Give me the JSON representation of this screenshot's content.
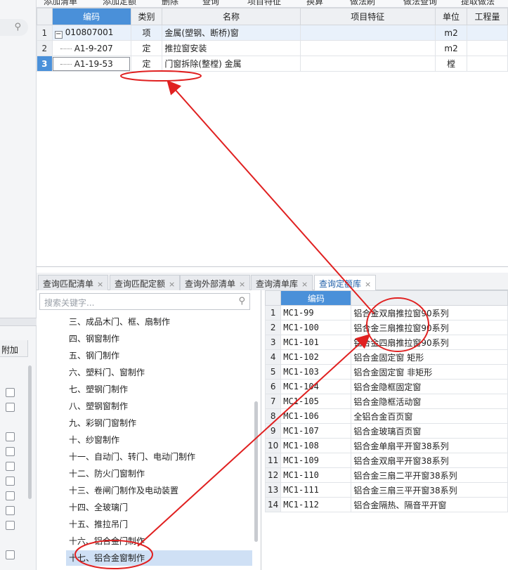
{
  "toolbar": {
    "items": [
      "添加清单",
      "添加定额",
      "删除",
      "查询",
      "项目特征",
      "换算",
      "做法刷",
      "做法查询",
      "提取做法"
    ]
  },
  "top_grid": {
    "headers": [
      "编码",
      "类别",
      "名称",
      "项目特征",
      "单位",
      "工程量"
    ],
    "rows": [
      {
        "num": "1",
        "code": "010807001",
        "type": "项",
        "name": "金属(塑钢、断桥)窗",
        "unit": "m2"
      },
      {
        "num": "2",
        "code": "A1-9-207",
        "type": "定",
        "name": "推拉窗安装",
        "unit": "m2"
      },
      {
        "num": "3",
        "code": "A1-19-53",
        "type": "定",
        "name": "门窗拆除(整樘) 金属",
        "unit": "樘"
      }
    ]
  },
  "tabs": [
    {
      "label": "查询匹配清单"
    },
    {
      "label": "查询匹配定额"
    },
    {
      "label": "查询外部清单"
    },
    {
      "label": "查询清单库"
    },
    {
      "label": "查询定额库"
    }
  ],
  "tree": {
    "search_placeholder": "搜索关键字...",
    "items": [
      "三、成品木门、框、扇制作",
      "四、钢窗制作",
      "五、钢门制作",
      "六、塑料门、窗制作",
      "七、塑钢门制作",
      "八、塑钢窗制作",
      "九、彩钢门窗制作",
      "十、纱窗制作",
      "十一、自动门、转门、电动门制作",
      "十二、防火门窗制作",
      "十三、卷闸门制作及电动装置",
      "十四、全玻璃门",
      "十五、推拉吊门",
      "十六、铝合金门制作",
      "十七、铝合金窗制作"
    ]
  },
  "quota_grid": {
    "header": "编码",
    "rows": [
      {
        "num": "1",
        "code": "MC1-99",
        "name": "铝合金双扇推拉窗90系列"
      },
      {
        "num": "2",
        "code": "MC1-100",
        "name": "铝合金三扇推拉窗90系列"
      },
      {
        "num": "3",
        "code": "MC1-101",
        "name": "铝合金四扇推拉窗90系列"
      },
      {
        "num": "4",
        "code": "MC1-102",
        "name": "铝合金固定窗 矩形"
      },
      {
        "num": "5",
        "code": "MC1-103",
        "name": "铝合金固定窗 非矩形"
      },
      {
        "num": "6",
        "code": "MC1-104",
        "name": "铝合金隐框固定窗"
      },
      {
        "num": "7",
        "code": "MC1-105",
        "name": "铝合金隐框活动窗"
      },
      {
        "num": "8",
        "code": "MC1-106",
        "name": "全铝合金百页窗"
      },
      {
        "num": "9",
        "code": "MC1-107",
        "name": "铝合金玻璃百页窗"
      },
      {
        "num": "10",
        "code": "MC1-108",
        "name": "铝合金单扇平开窗38系列"
      },
      {
        "num": "11",
        "code": "MC1-109",
        "name": "铝合金双扇平开窗38系列"
      },
      {
        "num": "12",
        "code": "MC1-110",
        "name": "铝合金三扇二平开窗38系列"
      },
      {
        "num": "13",
        "code": "MC1-111",
        "name": "铝合金三扇三平开窗38系列"
      },
      {
        "num": "14",
        "code": "MC1-112",
        "name": "铝合金隔热、隔音平开窗"
      }
    ]
  },
  "left_panel": {
    "column_label": "附加"
  },
  "colors": {
    "accent": "#4a90d9",
    "annotation_red": "#e02020"
  }
}
